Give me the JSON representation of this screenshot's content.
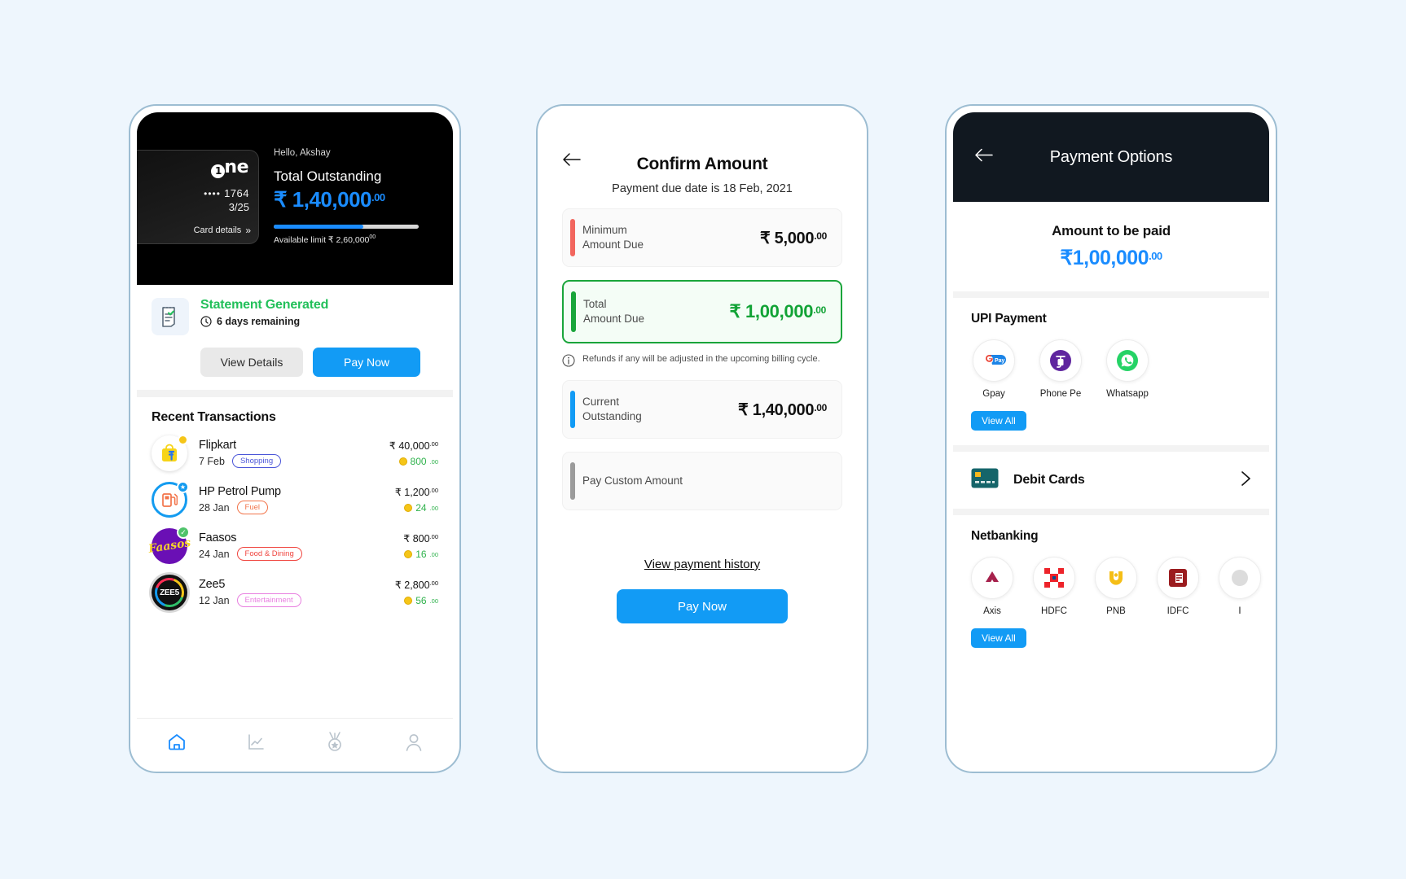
{
  "background_color": "#eef6fd",
  "accent_blue": "#129bf5",
  "phone1": {
    "card": {
      "brand": "one",
      "brand_zero": "0",
      "dots": "••••",
      "last4": "1764",
      "expiry": "3/25",
      "details_label": "Card details"
    },
    "greeting": "Hello, Akshay",
    "outstanding_label": "Total Outstanding",
    "outstanding_currency": "₹",
    "outstanding_amount": "1,40,000",
    "outstanding_decimals": ".00",
    "progress_percent": 62,
    "available_limit": "Available limit ₹ 2,60,000",
    "available_limit_decimals": "00",
    "statement": {
      "title": "Statement Generated",
      "subtitle": "6 days remaining",
      "view_details_label": "View Details",
      "pay_now_label": "Pay Now"
    },
    "recent_title": "Recent Transactions",
    "transactions": [
      {
        "merchant": "Flipkart",
        "date": "7 Feb",
        "category": "Shopping",
        "category_color": "#4a55d8",
        "amount": "₹ 40,000",
        "amount_decimals": ".00",
        "reward": "800",
        "reward_decimals": ".00",
        "icon": "flipkart-icon"
      },
      {
        "merchant": "HP Petrol Pump",
        "date": "28 Jan",
        "category": "Fuel",
        "category_color": "#f2744a",
        "amount": "₹ 1,200",
        "amount_decimals": ".00",
        "reward": "24",
        "reward_decimals": ".00",
        "icon": "fuel-pump-icon"
      },
      {
        "merchant": "Faasos",
        "date": "24 Jan",
        "category": "Food & Dining",
        "category_color": "#f0453f",
        "amount": "₹ 800",
        "amount_decimals": ".00",
        "reward": "16",
        "reward_decimals": ".00",
        "icon": "faasos-icon"
      },
      {
        "merchant": "Zee5",
        "date": "12 Jan",
        "category": "Entertainment",
        "category_color": "#e87fe0",
        "amount": "₹ 2,800",
        "amount_decimals": ".00",
        "reward": "56",
        "reward_decimals": ".00",
        "icon": "zee5-icon"
      }
    ],
    "tabs": [
      {
        "name": "home-tab",
        "icon": "home-icon",
        "active": true
      },
      {
        "name": "stats-tab",
        "icon": "chart-line-icon",
        "active": false
      },
      {
        "name": "rewards-tab",
        "icon": "medal-icon",
        "active": false
      },
      {
        "name": "profile-tab",
        "icon": "person-icon",
        "active": false
      }
    ]
  },
  "phone2": {
    "title": "Confirm Amount",
    "subtitle": "Payment due date is 18 Feb, 2021",
    "options": [
      {
        "label_line1": "Minimum",
        "label_line2": "Amount Due",
        "currency": "₹",
        "amount": "5,000",
        "decimals": ".00",
        "stripe_color": "#f2665e",
        "selected": false
      },
      {
        "label_line1": "Total",
        "label_line2": "Amount Due",
        "currency": "₹",
        "amount": "1,00,000",
        "decimals": ".00",
        "stripe_color": "#1aa53b",
        "selected": true
      },
      {
        "label_line1": "Current",
        "label_line2": "Outstanding",
        "currency": "₹",
        "amount": "1,40,000",
        "decimals": ".00",
        "stripe_color": "#129bf5",
        "selected": false
      },
      {
        "label_line1": "Pay Custom Amount",
        "label_line2": "",
        "currency": "",
        "amount": "",
        "decimals": "",
        "stripe_color": "#9b9b9b",
        "selected": false
      }
    ],
    "note": "Refunds if any will be adjusted in the upcoming billing cycle.",
    "history_link": "View payment history",
    "pay_now_label": "Pay Now"
  },
  "phone3": {
    "header_title": "Payment Options",
    "amount_label": "Amount to be paid",
    "amount_currency": "₹",
    "amount": "1,00,000",
    "amount_decimals": ".00",
    "upi": {
      "title": "UPI Payment",
      "view_all_label": "View All",
      "apps": [
        {
          "label": "Gpay",
          "icon": "gpay-icon"
        },
        {
          "label": "Phone Pe",
          "icon": "phonepe-icon"
        },
        {
          "label": "Whatsapp",
          "icon": "whatsapp-icon"
        }
      ]
    },
    "debit_cards": {
      "label": "Debit Cards",
      "icon": "credit-card-icon",
      "chevron": "chevron-right-icon"
    },
    "netbanking": {
      "title": "Netbanking",
      "view_all_label": "View All",
      "banks": [
        {
          "label": "Axis",
          "icon": "axis-bank-icon"
        },
        {
          "label": "HDFC",
          "icon": "hdfc-bank-icon"
        },
        {
          "label": "PNB",
          "icon": "pnb-bank-icon"
        },
        {
          "label": "IDFC",
          "icon": "idfc-bank-icon"
        },
        {
          "label": "I",
          "icon": "partial-bank-icon"
        }
      ]
    }
  }
}
